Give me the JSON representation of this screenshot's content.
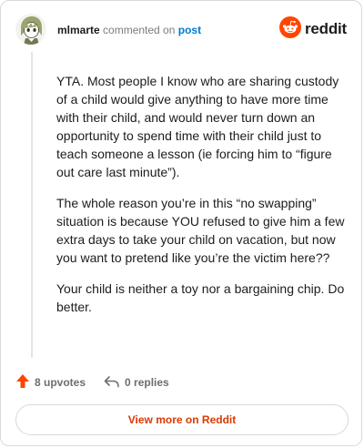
{
  "header": {
    "username": "mlmarte",
    "action_text": "commented on",
    "post_link": "post",
    "brand": "reddit"
  },
  "comment": {
    "paragraphs": [
      "YTA. Most people I know who are sharing custody of a child would give anything to have more time with their child, and would never turn down an opportunity to spend time with their child just to teach someone a lesson (ie forcing him to “figure out care last minute”).",
      "The whole reason you’re in this “no swapping” situation is because YOU refused to give him a few extra days to take your child on vacation, but now you want to pretend like you’re the victim here??",
      "Your child is neither a toy nor a bargaining chip. Do better."
    ]
  },
  "actions": {
    "upvotes": "8 upvotes",
    "replies": "0 replies"
  },
  "footer": {
    "view_more": "View more on Reddit"
  },
  "colors": {
    "upvote": "#ff4500",
    "link": "#0079d3",
    "view_more": "#d93a00"
  },
  "icons": {
    "avatar": "avatar-icon",
    "brand": "reddit-logo-icon",
    "upvote": "upvote-arrow-icon",
    "reply": "reply-arrow-icon"
  }
}
